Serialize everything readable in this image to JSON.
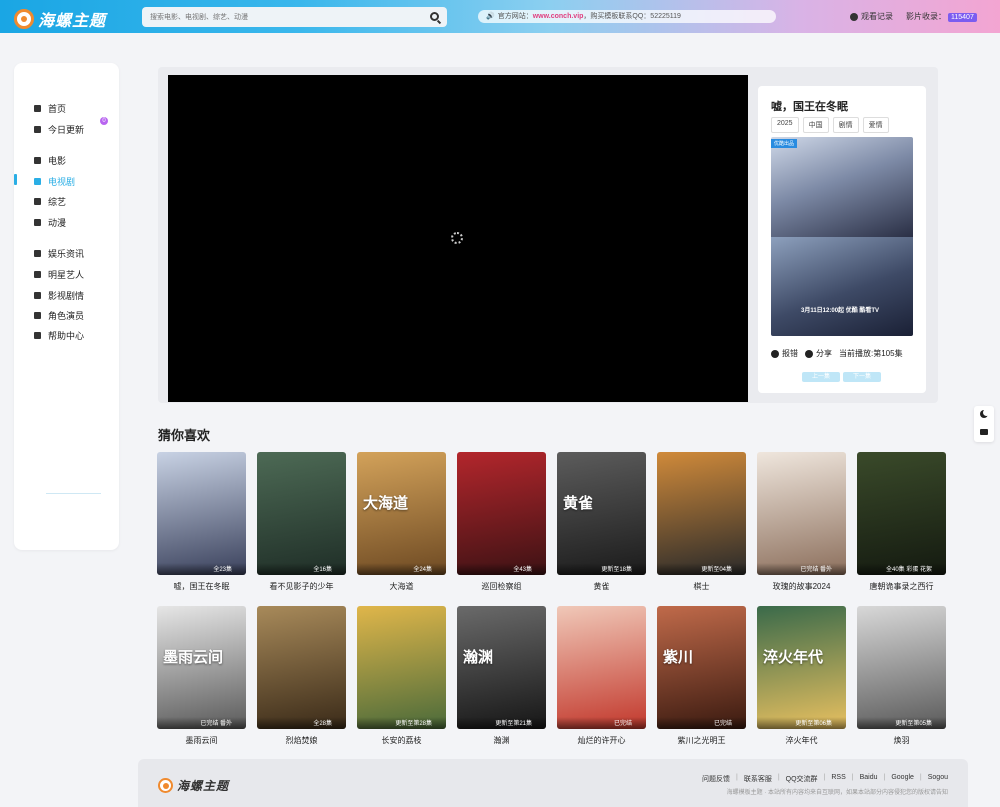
{
  "header": {
    "logo_text": "海螺主题",
    "search_placeholder": "搜索电影、电视剧、综艺、动漫",
    "notice_prefix": "🔊",
    "notice_text_1": "官方网站：",
    "notice_site": "www.conch.vip",
    "notice_text_2": "，购买模板联系QQ：52225119",
    "history_label": "观看记录",
    "count_label": "影片收录：",
    "count_value": "115407"
  },
  "sidebar": {
    "items": [
      {
        "label": "首页",
        "icon": "home-icon"
      },
      {
        "label": "今日更新",
        "icon": "calendar-icon"
      },
      {
        "label": "电影",
        "icon": "film-icon"
      },
      {
        "label": "电视剧",
        "icon": "tv-icon"
      },
      {
        "label": "综艺",
        "icon": "mic-icon"
      },
      {
        "label": "动漫",
        "icon": "cat-icon"
      },
      {
        "label": "娱乐资讯",
        "icon": "news-icon"
      },
      {
        "label": "明星艺人",
        "icon": "user-icon"
      },
      {
        "label": "影视剧情",
        "icon": "book-icon"
      },
      {
        "label": "角色演员",
        "icon": "mask-icon"
      },
      {
        "label": "帮助中心",
        "icon": "help-icon"
      }
    ],
    "new_badge": "0",
    "active_index": 3
  },
  "player": {
    "title": "嘘，国王在冬眠",
    "tags": [
      "2025",
      "中国",
      "剧情",
      "爱情"
    ],
    "poster_stamp": "优酷出品",
    "poster_airdate": "3月11日12:00起 优酷 酷看TV",
    "report_label": "报错",
    "share_label": "分享",
    "current_label": "当前播放:第105集",
    "prev_label": "上一集",
    "next_label": "下一集"
  },
  "recommend": {
    "title": "猜你喜欢",
    "items": [
      {
        "name": "嘘，国王在冬眠",
        "ep": "全23集",
        "poster_text": "",
        "colors": [
          "#c8d2e4",
          "#3a415c"
        ]
      },
      {
        "name": "看不见影子的少年",
        "ep": "全16集",
        "poster_text": "",
        "colors": [
          "#4d6a55",
          "#1f2e27"
        ]
      },
      {
        "name": "大海道",
        "ep": "全24集",
        "poster_text": "大海道",
        "colors": [
          "#d3a25a",
          "#6e4a23"
        ]
      },
      {
        "name": "巡回检察组",
        "ep": "全43集",
        "poster_text": "",
        "colors": [
          "#b3262c",
          "#3d1214"
        ]
      },
      {
        "name": "黄雀",
        "ep": "更新至18集",
        "poster_text": "黄雀",
        "colors": [
          "#5c5c5c",
          "#1b1b1b"
        ]
      },
      {
        "name": "棋士",
        "ep": "更新至04集",
        "poster_text": "",
        "colors": [
          "#d08a3a",
          "#2a2a2a"
        ]
      },
      {
        "name": "玫瑰的故事2024",
        "ep": "已完结 番外",
        "poster_text": "",
        "colors": [
          "#efe6dd",
          "#8c6f5c"
        ]
      },
      {
        "name": "唐朝诡事录之西行",
        "ep": "全40集 彩蛋 花絮",
        "poster_text": "",
        "colors": [
          "#3a4a2a",
          "#141a10"
        ]
      },
      {
        "name": "墨雨云间",
        "ep": "已完结 番外",
        "poster_text": "墨雨云间",
        "colors": [
          "#e6e6e6",
          "#5a5a5a"
        ]
      },
      {
        "name": "烈焰焚娘",
        "ep": "全28集",
        "poster_text": "",
        "colors": [
          "#a88a5a",
          "#3a2a18"
        ]
      },
      {
        "name": "长安的荔枝",
        "ep": "更新至第28集",
        "poster_text": "",
        "colors": [
          "#e0b64a",
          "#4a6a3a"
        ]
      },
      {
        "name": "瀚渊",
        "ep": "更新至第21集",
        "poster_text": "瀚渊",
        "colors": [
          "#6a6a6a",
          "#161616"
        ]
      },
      {
        "name": "灿烂的许开心",
        "ep": "已完结",
        "poster_text": "",
        "colors": [
          "#f0c8b8",
          "#c2382c"
        ]
      },
      {
        "name": "紫川之光明王",
        "ep": "已完结",
        "poster_text": "紫川",
        "colors": [
          "#c06a4a",
          "#3a1a10"
        ]
      },
      {
        "name": "淬火年代",
        "ep": "更新至第06集",
        "poster_text": "淬火年代",
        "colors": [
          "#3a6a4a",
          "#e8c060"
        ]
      },
      {
        "name": "焕羽",
        "ep": "更新至第05集",
        "poster_text": "",
        "colors": [
          "#d8d8d8",
          "#5a5a5a"
        ]
      }
    ]
  },
  "footer": {
    "logo_text": "海螺主题",
    "links": [
      "问题反馈",
      "联系客服",
      "QQ交流群",
      "RSS",
      "Baidu",
      "Google",
      "Sogou"
    ],
    "copyright": "海螺模板主题 · 本站所有内容均来自互联网，如果本站部分内容侵犯您的版权请告知"
  }
}
